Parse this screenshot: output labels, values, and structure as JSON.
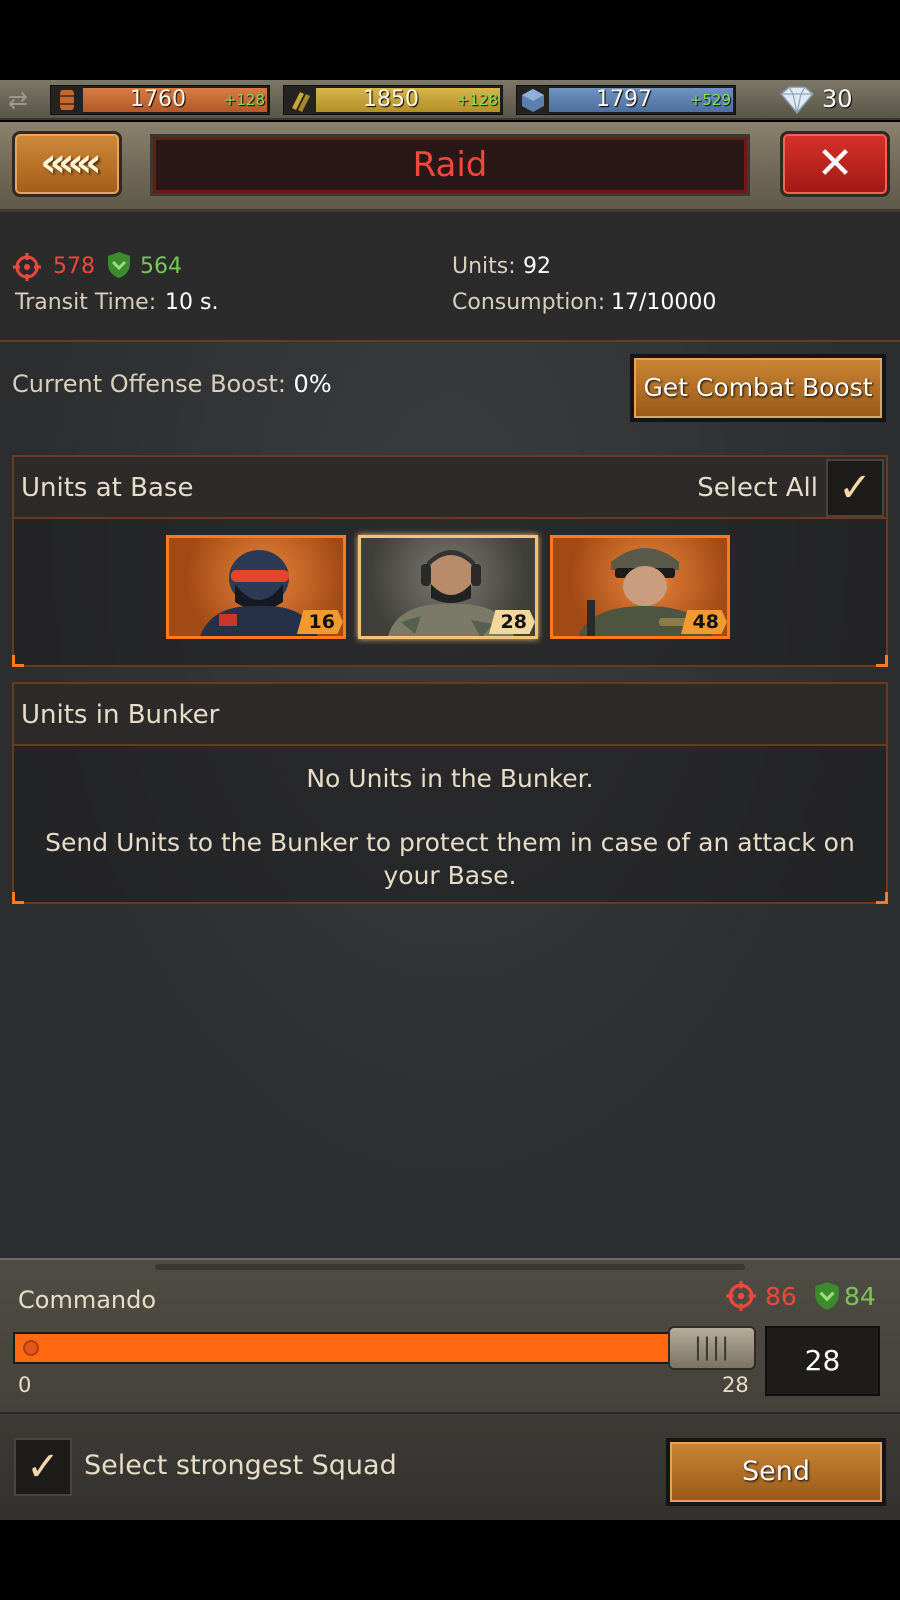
{
  "resources": {
    "oil": {
      "value": "1760",
      "rate": "+128",
      "color": "#c4672f",
      "icon": "oil-barrel-icon"
    },
    "ammo": {
      "value": "1850",
      "rate": "+128",
      "color": "#c7a53b",
      "icon": "ammo-icon"
    },
    "metal": {
      "value": "1797",
      "rate": "+529",
      "color": "#5b7fae",
      "icon": "metal-cube-icon"
    },
    "gems": "30"
  },
  "header": {
    "back_label": "«««",
    "title": "Raid",
    "close_label": "✕"
  },
  "stats": {
    "offense": "578",
    "defense": "564",
    "transit_label": "Transit Time:",
    "transit_value": "10 s.",
    "units_label": "Units:",
    "units_value": "92",
    "consumption_label": "Consumption:",
    "consumption_value": "17/10000"
  },
  "boost": {
    "label": "Current Offense Boost:",
    "value": "0%",
    "button": "Get Combat Boost"
  },
  "base_panel": {
    "title": "Units at Base",
    "select_all": "Select All",
    "select_all_checked": true,
    "units": [
      {
        "name": "unit-special-forces",
        "count": "16",
        "selected": false
      },
      {
        "name": "unit-commando",
        "count": "28",
        "selected": true
      },
      {
        "name": "unit-rifleman",
        "count": "48",
        "selected": false
      }
    ]
  },
  "bunker_panel": {
    "title": "Units in Bunker",
    "empty_title": "No Units in the Bunker.",
    "empty_body": "Send Units to the Bunker to protect them in case of an attack on your Base."
  },
  "selected_unit": {
    "name": "Commando",
    "offense": "86",
    "defense": "84",
    "min": "0",
    "max": "28",
    "quantity": "28",
    "fill_fraction": 1.0
  },
  "footer": {
    "strongest_label": "Select strongest Squad",
    "strongest_checked": true,
    "send_label": "Send"
  }
}
